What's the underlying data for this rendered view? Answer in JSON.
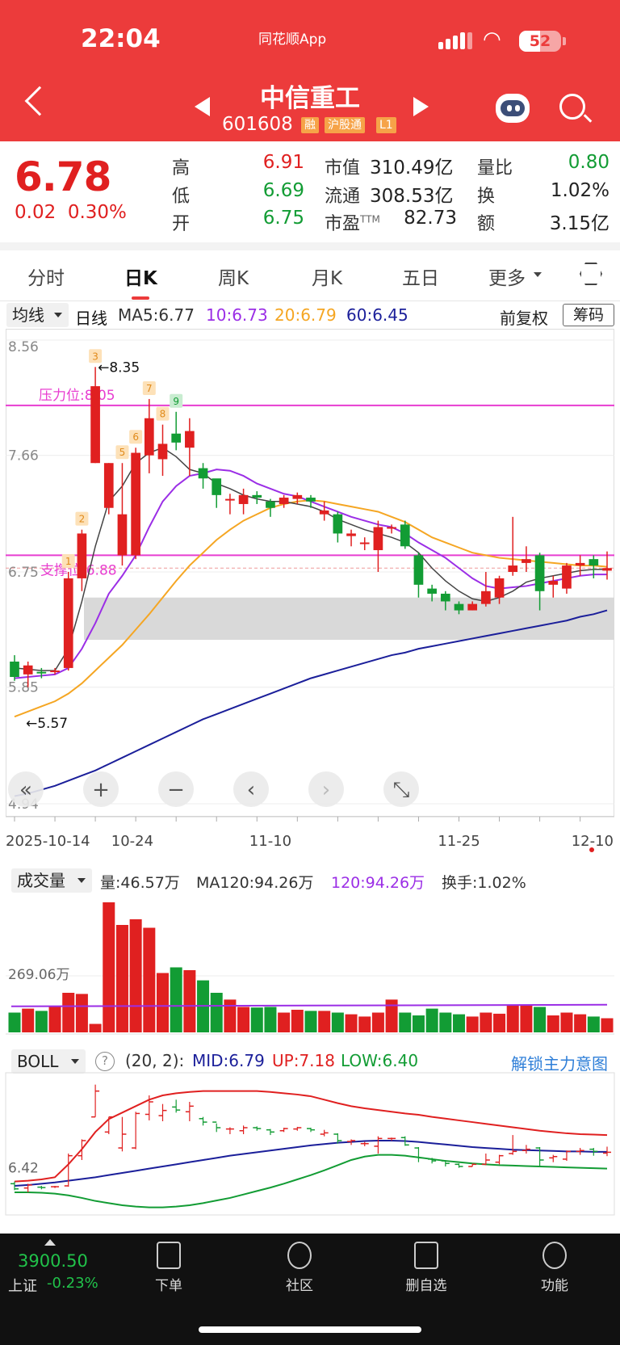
{
  "status": {
    "time": "22:04",
    "app": "同花顺App",
    "battery": "52"
  },
  "stock": {
    "name": "中信重工",
    "code": "601608",
    "tags": [
      "融",
      "沪股通",
      "L1"
    ]
  },
  "quote": {
    "price": "6.78",
    "change": "0.02",
    "change_pct": "0.30%",
    "high_label": "高",
    "high": "6.91",
    "low_label": "低",
    "low": "6.69",
    "open_label": "开",
    "open": "6.75",
    "mcap_label": "市值",
    "mcap": "310.49亿",
    "float_label": "流通",
    "float": "308.53亿",
    "pe_label": "市盈",
    "pe_sup": "TTM",
    "pe": "82.73",
    "vr_label": "量比",
    "vr": "0.80",
    "turn_label": "换",
    "turn": "1.02%",
    "amt_label": "额",
    "amt": "3.15亿"
  },
  "tabs": [
    "分时",
    "日K",
    "周K",
    "月K",
    "五日",
    "更多"
  ],
  "ma_bar": {
    "select": "均线",
    "period": "日线",
    "ma5": "MA5:6.77",
    "ma10": "10:6.73",
    "ma20": "20:6.79",
    "ma60": "60:6.45",
    "adjust": "前复权",
    "chips": "筹码"
  },
  "colors": {
    "ma5": "#444444",
    "ma10": "#9b2ee6",
    "ma20": "#f5a623",
    "ma60": "#1b1f9a",
    "up": "#e02020",
    "down": "#129c34",
    "line": "#e83dd1"
  },
  "kchart": {
    "y_labels": [
      "8.56",
      "7.66",
      "6.75",
      "5.85",
      "4.94"
    ],
    "x_labels": [
      "2025-10-14",
      "10-24",
      "11-10",
      "11-25",
      "12-10"
    ],
    "pressure_label": "压力位:8.05",
    "support_label": "支撑位:6.88",
    "max_label": "8.35",
    "min_label": "5.57",
    "markers": [
      "1",
      "2",
      "3",
      "5",
      "6",
      "7",
      "8",
      "9"
    ]
  },
  "chart_data": {
    "type": "candlestick",
    "ylim": [
      4.94,
      8.56
    ],
    "candles": [
      [
        6.05,
        5.93,
        6.1,
        5.9
      ],
      [
        5.95,
        6.02,
        6.05,
        5.85
      ],
      [
        5.97,
        5.96,
        6.0,
        5.92
      ],
      [
        5.98,
        5.98,
        6.0,
        5.95
      ],
      [
        6.0,
        6.7,
        6.75,
        5.98
      ],
      [
        6.7,
        7.05,
        7.08,
        6.6
      ],
      [
        7.6,
        8.2,
        8.35,
        7.6
      ],
      [
        7.25,
        7.6,
        7.6,
        7.2
      ],
      [
        6.88,
        7.2,
        7.6,
        6.8
      ],
      [
        6.88,
        7.68,
        7.72,
        6.85
      ],
      [
        7.66,
        7.95,
        8.1,
        7.52
      ],
      [
        7.63,
        7.75,
        7.9,
        7.5
      ],
      [
        7.83,
        7.76,
        8.0,
        7.7
      ],
      [
        7.72,
        7.85,
        7.95,
        7.5
      ],
      [
        7.56,
        7.48,
        7.6,
        7.4
      ],
      [
        7.48,
        7.35,
        7.45,
        7.25
      ],
      [
        7.32,
        7.32,
        7.36,
        7.2
      ],
      [
        7.28,
        7.35,
        7.4,
        7.2
      ],
      [
        7.35,
        7.33,
        7.38,
        7.28
      ],
      [
        7.3,
        7.25,
        7.32,
        7.18
      ],
      [
        7.28,
        7.33,
        7.35,
        7.25
      ],
      [
        7.32,
        7.35,
        7.37,
        7.28
      ],
      [
        7.33,
        7.3,
        7.35,
        7.25
      ],
      [
        7.2,
        7.23,
        7.3,
        7.15
      ],
      [
        7.2,
        7.05,
        7.22,
        6.98
      ],
      [
        7.03,
        7.05,
        7.08,
        6.95
      ],
      [
        6.98,
        6.98,
        7.02,
        6.92
      ],
      [
        6.92,
        7.1,
        7.15,
        6.75
      ],
      [
        7.1,
        7.1,
        7.12,
        7.05
      ],
      [
        7.12,
        6.95,
        7.15,
        6.93
      ],
      [
        6.88,
        6.65,
        6.9,
        6.55
      ],
      [
        6.62,
        6.58,
        6.65,
        6.52
      ],
      [
        6.58,
        6.52,
        6.6,
        6.45
      ],
      [
        6.5,
        6.45,
        6.52,
        6.42
      ],
      [
        6.45,
        6.5,
        6.52,
        6.45
      ],
      [
        6.5,
        6.6,
        6.75,
        6.48
      ],
      [
        6.55,
        6.7,
        6.72,
        6.5
      ],
      [
        6.75,
        6.8,
        7.18,
        6.72
      ],
      [
        6.82,
        6.85,
        6.95,
        6.75
      ],
      [
        6.88,
        6.6,
        6.9,
        6.45
      ],
      [
        6.65,
        6.68,
        6.72,
        6.55
      ],
      [
        6.62,
        6.8,
        6.82,
        6.58
      ],
      [
        6.8,
        6.82,
        6.88,
        6.72
      ],
      [
        6.85,
        6.8,
        6.88,
        6.7
      ],
      [
        6.76,
        6.78,
        6.91,
        6.69
      ]
    ],
    "ma5": [
      6.0,
      5.99,
      5.98,
      5.98,
      6.15,
      6.52,
      6.95,
      7.3,
      7.42,
      7.6,
      7.68,
      7.72,
      7.65,
      7.55,
      7.52,
      7.44,
      7.4,
      7.35,
      7.32,
      7.3,
      7.3,
      7.28,
      7.26,
      7.22,
      7.16,
      7.12,
      7.08,
      7.05,
      7.02,
      6.98,
      6.9,
      6.78,
      6.68,
      6.6,
      6.54,
      6.52,
      6.55,
      6.6,
      6.67,
      6.7,
      6.72,
      6.74,
      6.76,
      6.77,
      6.77
    ],
    "ma10": [
      5.92,
      5.93,
      5.94,
      5.95,
      6.0,
      6.15,
      6.35,
      6.58,
      6.72,
      6.88,
      7.1,
      7.3,
      7.42,
      7.5,
      7.52,
      7.55,
      7.54,
      7.5,
      7.44,
      7.4,
      7.36,
      7.34,
      7.3,
      7.26,
      7.22,
      7.18,
      7.15,
      7.12,
      7.1,
      7.05,
      6.98,
      6.92,
      6.86,
      6.78,
      6.7,
      6.64,
      6.62,
      6.63,
      6.64,
      6.66,
      6.68,
      6.7,
      6.72,
      6.73,
      6.73
    ],
    "ma20": [
      5.62,
      5.66,
      5.7,
      5.74,
      5.8,
      5.88,
      5.98,
      6.08,
      6.18,
      6.3,
      6.42,
      6.55,
      6.68,
      6.8,
      6.9,
      7.0,
      7.08,
      7.15,
      7.2,
      7.25,
      7.28,
      7.3,
      7.31,
      7.3,
      7.28,
      7.26,
      7.24,
      7.22,
      7.18,
      7.14,
      7.08,
      7.02,
      6.98,
      6.94,
      6.9,
      6.88,
      6.86,
      6.85,
      6.84,
      6.83,
      6.82,
      6.81,
      6.8,
      6.8,
      6.79
    ],
    "ma60": [
      5.0,
      5.02,
      5.05,
      5.08,
      5.12,
      5.16,
      5.2,
      5.25,
      5.3,
      5.35,
      5.4,
      5.45,
      5.5,
      5.55,
      5.6,
      5.64,
      5.68,
      5.72,
      5.76,
      5.8,
      5.84,
      5.88,
      5.92,
      5.95,
      5.98,
      6.01,
      6.04,
      6.07,
      6.1,
      6.12,
      6.15,
      6.17,
      6.19,
      6.21,
      6.23,
      6.25,
      6.27,
      6.29,
      6.31,
      6.33,
      6.35,
      6.37,
      6.4,
      6.42,
      6.45
    ],
    "pressure": 8.05,
    "support": 6.88,
    "volume": [
      0.35,
      0.42,
      0.38,
      0.45,
      0.7,
      0.68,
      0.15,
      2.3,
      1.9,
      2.0,
      1.85,
      1.05,
      1.15,
      1.1,
      0.92,
      0.7,
      0.58,
      0.45,
      0.44,
      0.45,
      0.35,
      0.4,
      0.38,
      0.38,
      0.35,
      0.32,
      0.28,
      0.35,
      0.58,
      0.35,
      0.3,
      0.42,
      0.35,
      0.32,
      0.28,
      0.35,
      0.33,
      0.48,
      0.48,
      0.45,
      0.3,
      0.35,
      0.32,
      0.28,
      0.25
    ],
    "vol_ma": 0.46,
    "vol_ylim": [
      0,
      2.4
    ],
    "boll_mid": [
      6.0,
      6.02,
      6.05,
      6.08,
      6.12,
      6.16,
      6.2,
      6.25,
      6.3,
      6.35,
      6.4,
      6.45,
      6.5,
      6.55,
      6.6,
      6.65,
      6.7,
      6.74,
      6.78,
      6.82,
      6.86,
      6.9,
      6.94,
      6.97,
      7.0,
      7.02,
      7.04,
      7.05,
      7.05,
      7.04,
      7.02,
      6.99,
      6.96,
      6.93,
      6.9,
      6.88,
      6.86,
      6.84,
      6.83,
      6.82,
      6.81,
      6.8,
      6.8,
      6.79,
      6.79
    ],
    "boll_up": [
      6.1,
      6.12,
      6.15,
      6.2,
      6.5,
      6.85,
      7.25,
      7.55,
      7.7,
      7.85,
      8.0,
      8.1,
      8.15,
      8.18,
      8.2,
      8.2,
      8.2,
      8.2,
      8.2,
      8.18,
      8.15,
      8.12,
      8.08,
      8.0,
      7.92,
      7.85,
      7.8,
      7.76,
      7.72,
      7.68,
      7.65,
      7.6,
      7.56,
      7.52,
      7.48,
      7.44,
      7.4,
      7.36,
      7.32,
      7.28,
      7.25,
      7.22,
      7.2,
      7.19,
      7.18
    ],
    "boll_low": [
      5.85,
      5.85,
      5.84,
      5.82,
      5.78,
      5.72,
      5.65,
      5.6,
      5.55,
      5.52,
      5.5,
      5.5,
      5.52,
      5.55,
      5.6,
      5.66,
      5.72,
      5.8,
      5.88,
      5.96,
      6.05,
      6.15,
      6.25,
      6.36,
      6.48,
      6.6,
      6.68,
      6.72,
      6.72,
      6.7,
      6.66,
      6.62,
      6.58,
      6.55,
      6.52,
      6.5,
      6.48,
      6.47,
      6.46,
      6.45,
      6.44,
      6.43,
      6.42,
      6.41,
      6.4
    ],
    "boll_ylim": [
      5.4,
      8.4
    ]
  },
  "volume_bar": {
    "select": "成交量",
    "vol": "量:46.57万",
    "ma120": "MA120:94.26万",
    "v120": "120:94.26万",
    "turnover": "换手:1.02%",
    "y_label": "269.06万"
  },
  "boll_bar": {
    "select": "BOLL",
    "params": "(20, 2):",
    "mid": "MID:6.79",
    "up": "UP:7.18",
    "low": "LOW:6.40",
    "unlock": "解锁主力意图",
    "y_label": "6.42"
  },
  "bottom": {
    "index_val": "3900.50",
    "index_name": "上证",
    "index_chg": "-0.23%",
    "nav": [
      "下单",
      "社区",
      "删自选",
      "功能"
    ]
  }
}
